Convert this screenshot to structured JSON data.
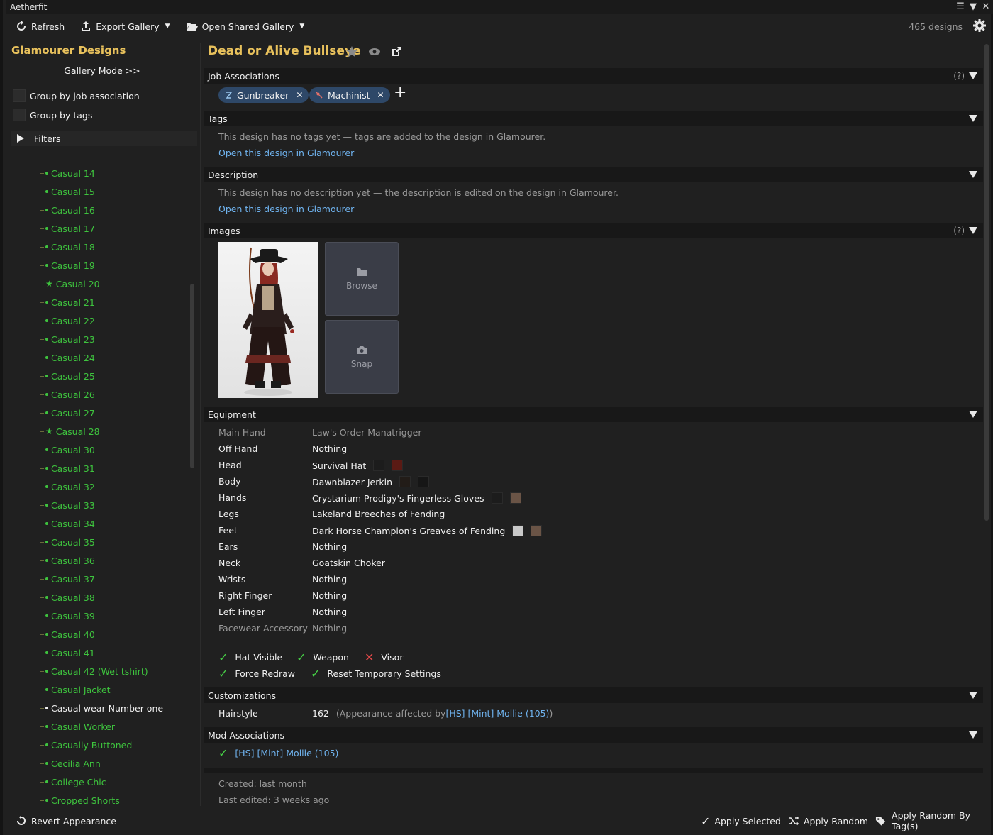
{
  "app": {
    "title": "Aetherfit"
  },
  "toolbar": {
    "refresh": "Refresh",
    "export": "Export Gallery",
    "open_shared": "Open Shared Gallery",
    "count": "465 designs"
  },
  "sidebar": {
    "title": "Glamourer Designs",
    "gallery_mode": "Gallery Mode >>",
    "group_job": "Group by job association",
    "group_tags": "Group by tags",
    "filters": "Filters",
    "items": [
      {
        "label": "Casual 14",
        "mark": "dot"
      },
      {
        "label": "Casual 15",
        "mark": "dot"
      },
      {
        "label": "Casual 16",
        "mark": "dot"
      },
      {
        "label": "Casual 17",
        "mark": "dot"
      },
      {
        "label": "Casual 18",
        "mark": "dot"
      },
      {
        "label": "Casual 19",
        "mark": "dot"
      },
      {
        "label": "Casual 20",
        "mark": "star"
      },
      {
        "label": "Casual 21",
        "mark": "dot"
      },
      {
        "label": "Casual 22",
        "mark": "dot"
      },
      {
        "label": "Casual 23",
        "mark": "dot"
      },
      {
        "label": "Casual 24",
        "mark": "dot"
      },
      {
        "label": "Casual 25",
        "mark": "dot"
      },
      {
        "label": "Casual 26",
        "mark": "dot"
      },
      {
        "label": "Casual 27",
        "mark": "dot"
      },
      {
        "label": "Casual 28",
        "mark": "star"
      },
      {
        "label": "Casual 30",
        "mark": "dot"
      },
      {
        "label": "Casual 31",
        "mark": "dot"
      },
      {
        "label": "Casual 32",
        "mark": "dot"
      },
      {
        "label": "Casual 33",
        "mark": "dot"
      },
      {
        "label": "Casual 34",
        "mark": "dot"
      },
      {
        "label": "Casual 35",
        "mark": "dot"
      },
      {
        "label": "Casual 36",
        "mark": "dot"
      },
      {
        "label": "Casual 37",
        "mark": "dot"
      },
      {
        "label": "Casual 38",
        "mark": "dot"
      },
      {
        "label": "Casual 39",
        "mark": "dot"
      },
      {
        "label": "Casual 40",
        "mark": "dot"
      },
      {
        "label": "Casual 41",
        "mark": "dot"
      },
      {
        "label": "Casual 42 (Wet tshirt)",
        "mark": "dot"
      },
      {
        "label": "Casual Jacket",
        "mark": "dot"
      },
      {
        "label": "Casual wear Number one",
        "mark": "dot",
        "white": true
      },
      {
        "label": "Casual Worker",
        "mark": "dot"
      },
      {
        "label": "Casually Buttoned",
        "mark": "dot"
      },
      {
        "label": "Cecilia Ann",
        "mark": "dot"
      },
      {
        "label": "College Chic",
        "mark": "dot"
      },
      {
        "label": "Cropped Shorts",
        "mark": "dot"
      }
    ]
  },
  "design": {
    "title": "Dead or Alive Bullseye",
    "sections": {
      "jobs": "Job Associations",
      "tags": "Tags",
      "description": "Description",
      "images": "Images",
      "equipment": "Equipment",
      "customizations": "Customizations",
      "mods": "Mod Associations"
    },
    "help": "(?)",
    "jobs": [
      {
        "name": "Gunbreaker",
        "icon": "gunbreaker-icon"
      },
      {
        "name": "Machinist",
        "icon": "machinist-icon"
      }
    ],
    "tags_empty": "This design has no tags yet — tags are added to the design in Glamourer.",
    "description_empty": "This design has no description yet — the description is edited on the design in Glamourer.",
    "open_link": "Open this design in Glamourer",
    "image_buttons": {
      "browse": "Browse",
      "snap": "Snap"
    },
    "equipment": [
      {
        "slot": "Main Hand",
        "item": "Law's Order Manatrigger",
        "dim": true,
        "swatches": []
      },
      {
        "slot": "Off Hand",
        "item": "Nothing",
        "swatches": []
      },
      {
        "slot": "Head",
        "item": "Survival Hat",
        "swatches": [
          "#1c1c1c",
          "#5a1a14"
        ]
      },
      {
        "slot": "Body",
        "item": "Dawnblazer Jerkin",
        "swatches": [
          "#221c18",
          "#161616"
        ]
      },
      {
        "slot": "Hands",
        "item": "Crystarium Prodigy's Fingerless Gloves",
        "swatches": [
          "#1c1c1c",
          "#6a5446"
        ]
      },
      {
        "slot": "Legs",
        "item": "Lakeland Breeches of Fending",
        "swatches": []
      },
      {
        "slot": "Feet",
        "item": "Dark Horse Champion's Greaves of Fending",
        "swatches": [
          "#c8c8c8",
          "#6a5446"
        ]
      },
      {
        "slot": "Ears",
        "item": "Nothing",
        "swatches": []
      },
      {
        "slot": "Neck",
        "item": "Goatskin Choker",
        "swatches": []
      },
      {
        "slot": "Wrists",
        "item": "Nothing",
        "swatches": []
      },
      {
        "slot": "Right Finger",
        "item": "Nothing",
        "swatches": []
      },
      {
        "slot": "Left Finger",
        "item": "Nothing",
        "swatches": []
      },
      {
        "slot": "Facewear Accessory",
        "item": "Nothing",
        "dim": true,
        "swatches": []
      }
    ],
    "flags": {
      "hat_visible": "Hat Visible",
      "weapon": "Weapon",
      "visor": "Visor",
      "force_redraw": "Force Redraw",
      "reset_temp": "Reset Temporary Settings"
    },
    "customizations": {
      "label": "Hairstyle",
      "value": "162",
      "note_prefix": "(Appearance affected by ",
      "note_link": "[HS] [Mint] Mollie (105)",
      "note_suffix": ")"
    },
    "mod": "[HS] [Mint] Mollie (105)",
    "created": "Created: last month",
    "edited": "Last edited: 3 weeks ago"
  },
  "bottom": {
    "revert": "Revert Appearance",
    "apply_selected": "Apply Selected",
    "apply_random": "Apply Random",
    "apply_random_tags": "Apply Random By Tag(s)"
  },
  "colors": {
    "accent_gold": "#e8c15c",
    "link_blue": "#6fb3ef",
    "tree_green": "#3ec43e",
    "chip_blue": "#2e4868"
  }
}
